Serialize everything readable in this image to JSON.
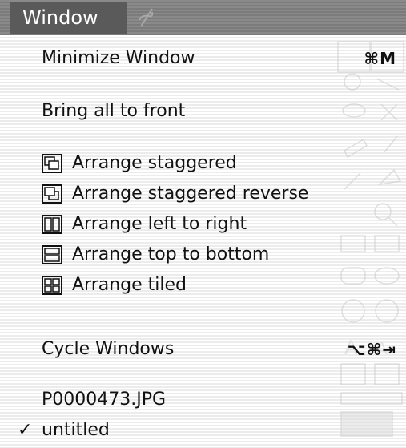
{
  "menubar": {
    "title": "Window"
  },
  "items": {
    "minimize": {
      "label": "Minimize Window",
      "shortcut": "⌘M"
    },
    "bring_front": {
      "label": "Bring all to front"
    },
    "staggered": {
      "label": "Arrange staggered",
      "icon": "arrange-staggered-icon"
    },
    "staggered_reverse": {
      "label": "Arrange staggered reverse",
      "icon": "arrange-staggered-reverse-icon"
    },
    "left_right": {
      "label": "Arrange left to right",
      "icon": "arrange-left-right-icon"
    },
    "top_bottom": {
      "label": "Arrange top to bottom",
      "icon": "arrange-top-bottom-icon"
    },
    "tiled": {
      "label": "Arrange tiled",
      "icon": "arrange-tiled-icon"
    },
    "cycle": {
      "label": "Cycle Windows",
      "shortcut": "⌥⌘⇥"
    },
    "file1": {
      "label": "P0000473.JPG"
    },
    "file2": {
      "label": "untitled",
      "check": "✓"
    }
  }
}
